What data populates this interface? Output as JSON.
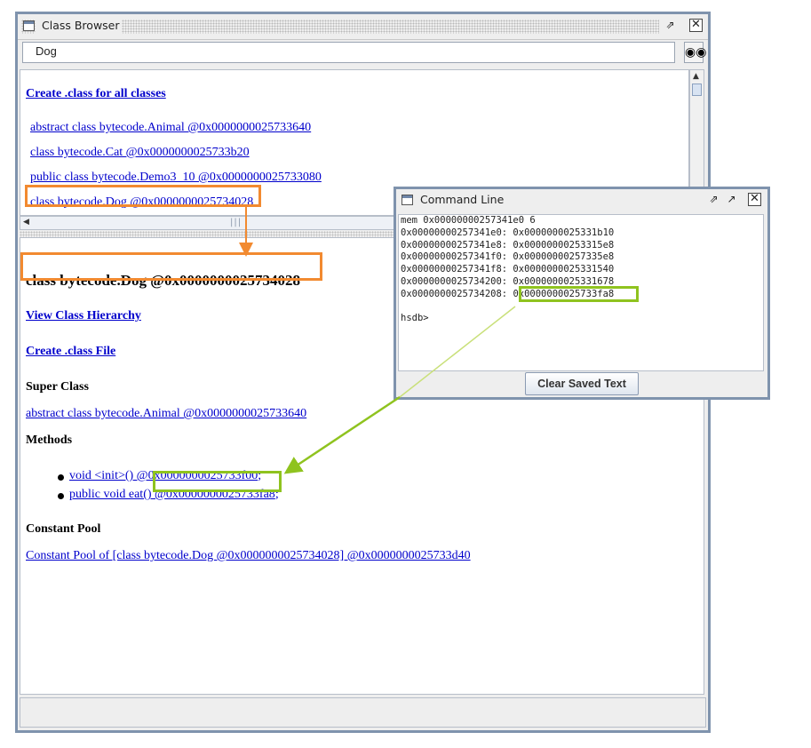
{
  "class_browser": {
    "title": "Class Browser",
    "search_value": "Dog",
    "create_all_link": "Create .class for all classes",
    "classes": [
      "abstract class bytecode.Animal @0x0000000025733640",
      "class bytecode.Cat @0x0000000025733b20",
      "public class bytecode.Demo3_10 @0x0000000025733080",
      "class bytecode.Dog @0x0000000025734028"
    ],
    "detail": {
      "title": "class bytecode.Dog @0x0000000025734028",
      "view_hierarchy": "View Class Hierarchy",
      "create_class_file": "Create .class File",
      "super_class_heading": "Super Class",
      "super_class_link": "abstract class bytecode.Animal @0x0000000025733640",
      "methods_heading": "Methods",
      "methods": [
        {
          "link": "void <init>() @0x0000000025733f00",
          "suffix": ";"
        },
        {
          "link_prefix": "public void eat() ",
          "link_addr": "@0x0000000025733fa8",
          "suffix": ";"
        }
      ],
      "constant_pool_heading": "Constant Pool",
      "constant_pool_link": "Constant Pool of [class bytecode.Dog @0x0000000025734028] @0x0000000025733d40"
    }
  },
  "command_line": {
    "title": "Command Line",
    "lines": [
      "mem 0x00000000257341e0 6",
      "0x00000000257341e0: 0x0000000025331b10",
      "0x00000000257341e8: 0x00000000253315e8",
      "0x00000000257341f0: 0x00000000257335e8",
      "0x00000000257341f8: 0x0000000025331540",
      "0x0000000025734200: 0x0000000025331678"
    ],
    "last_addr_line": "0x0000000025734208: ",
    "last_value": "0x0000000025733fa8",
    "prompt": "hsdb>",
    "clear_button": "Clear Saved Text"
  },
  "colors": {
    "highlight_orange": "#f28a30",
    "highlight_green": "#8fc31f",
    "link": "#0000cc"
  }
}
